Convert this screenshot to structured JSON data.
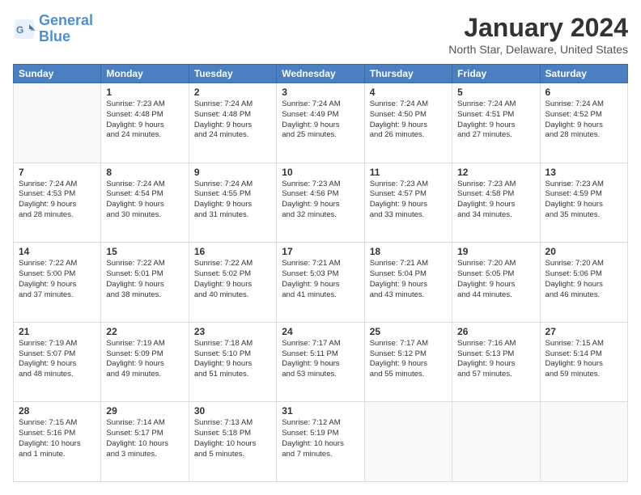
{
  "header": {
    "logo_line1": "General",
    "logo_line2": "Blue",
    "month_title": "January 2024",
    "location": "North Star, Delaware, United States"
  },
  "days_of_week": [
    "Sunday",
    "Monday",
    "Tuesday",
    "Wednesday",
    "Thursday",
    "Friday",
    "Saturday"
  ],
  "weeks": [
    [
      {
        "day": "",
        "info": ""
      },
      {
        "day": "1",
        "info": "Sunrise: 7:23 AM\nSunset: 4:48 PM\nDaylight: 9 hours\nand 24 minutes."
      },
      {
        "day": "2",
        "info": "Sunrise: 7:24 AM\nSunset: 4:48 PM\nDaylight: 9 hours\nand 24 minutes."
      },
      {
        "day": "3",
        "info": "Sunrise: 7:24 AM\nSunset: 4:49 PM\nDaylight: 9 hours\nand 25 minutes."
      },
      {
        "day": "4",
        "info": "Sunrise: 7:24 AM\nSunset: 4:50 PM\nDaylight: 9 hours\nand 26 minutes."
      },
      {
        "day": "5",
        "info": "Sunrise: 7:24 AM\nSunset: 4:51 PM\nDaylight: 9 hours\nand 27 minutes."
      },
      {
        "day": "6",
        "info": "Sunrise: 7:24 AM\nSunset: 4:52 PM\nDaylight: 9 hours\nand 28 minutes."
      }
    ],
    [
      {
        "day": "7",
        "info": "Sunrise: 7:24 AM\nSunset: 4:53 PM\nDaylight: 9 hours\nand 28 minutes."
      },
      {
        "day": "8",
        "info": "Sunrise: 7:24 AM\nSunset: 4:54 PM\nDaylight: 9 hours\nand 30 minutes."
      },
      {
        "day": "9",
        "info": "Sunrise: 7:24 AM\nSunset: 4:55 PM\nDaylight: 9 hours\nand 31 minutes."
      },
      {
        "day": "10",
        "info": "Sunrise: 7:23 AM\nSunset: 4:56 PM\nDaylight: 9 hours\nand 32 minutes."
      },
      {
        "day": "11",
        "info": "Sunrise: 7:23 AM\nSunset: 4:57 PM\nDaylight: 9 hours\nand 33 minutes."
      },
      {
        "day": "12",
        "info": "Sunrise: 7:23 AM\nSunset: 4:58 PM\nDaylight: 9 hours\nand 34 minutes."
      },
      {
        "day": "13",
        "info": "Sunrise: 7:23 AM\nSunset: 4:59 PM\nDaylight: 9 hours\nand 35 minutes."
      }
    ],
    [
      {
        "day": "14",
        "info": "Sunrise: 7:22 AM\nSunset: 5:00 PM\nDaylight: 9 hours\nand 37 minutes."
      },
      {
        "day": "15",
        "info": "Sunrise: 7:22 AM\nSunset: 5:01 PM\nDaylight: 9 hours\nand 38 minutes."
      },
      {
        "day": "16",
        "info": "Sunrise: 7:22 AM\nSunset: 5:02 PM\nDaylight: 9 hours\nand 40 minutes."
      },
      {
        "day": "17",
        "info": "Sunrise: 7:21 AM\nSunset: 5:03 PM\nDaylight: 9 hours\nand 41 minutes."
      },
      {
        "day": "18",
        "info": "Sunrise: 7:21 AM\nSunset: 5:04 PM\nDaylight: 9 hours\nand 43 minutes."
      },
      {
        "day": "19",
        "info": "Sunrise: 7:20 AM\nSunset: 5:05 PM\nDaylight: 9 hours\nand 44 minutes."
      },
      {
        "day": "20",
        "info": "Sunrise: 7:20 AM\nSunset: 5:06 PM\nDaylight: 9 hours\nand 46 minutes."
      }
    ],
    [
      {
        "day": "21",
        "info": "Sunrise: 7:19 AM\nSunset: 5:07 PM\nDaylight: 9 hours\nand 48 minutes."
      },
      {
        "day": "22",
        "info": "Sunrise: 7:19 AM\nSunset: 5:09 PM\nDaylight: 9 hours\nand 49 minutes."
      },
      {
        "day": "23",
        "info": "Sunrise: 7:18 AM\nSunset: 5:10 PM\nDaylight: 9 hours\nand 51 minutes."
      },
      {
        "day": "24",
        "info": "Sunrise: 7:17 AM\nSunset: 5:11 PM\nDaylight: 9 hours\nand 53 minutes."
      },
      {
        "day": "25",
        "info": "Sunrise: 7:17 AM\nSunset: 5:12 PM\nDaylight: 9 hours\nand 55 minutes."
      },
      {
        "day": "26",
        "info": "Sunrise: 7:16 AM\nSunset: 5:13 PM\nDaylight: 9 hours\nand 57 minutes."
      },
      {
        "day": "27",
        "info": "Sunrise: 7:15 AM\nSunset: 5:14 PM\nDaylight: 9 hours\nand 59 minutes."
      }
    ],
    [
      {
        "day": "28",
        "info": "Sunrise: 7:15 AM\nSunset: 5:16 PM\nDaylight: 10 hours\nand 1 minute."
      },
      {
        "day": "29",
        "info": "Sunrise: 7:14 AM\nSunset: 5:17 PM\nDaylight: 10 hours\nand 3 minutes."
      },
      {
        "day": "30",
        "info": "Sunrise: 7:13 AM\nSunset: 5:18 PM\nDaylight: 10 hours\nand 5 minutes."
      },
      {
        "day": "31",
        "info": "Sunrise: 7:12 AM\nSunset: 5:19 PM\nDaylight: 10 hours\nand 7 minutes."
      },
      {
        "day": "",
        "info": ""
      },
      {
        "day": "",
        "info": ""
      },
      {
        "day": "",
        "info": ""
      }
    ]
  ]
}
